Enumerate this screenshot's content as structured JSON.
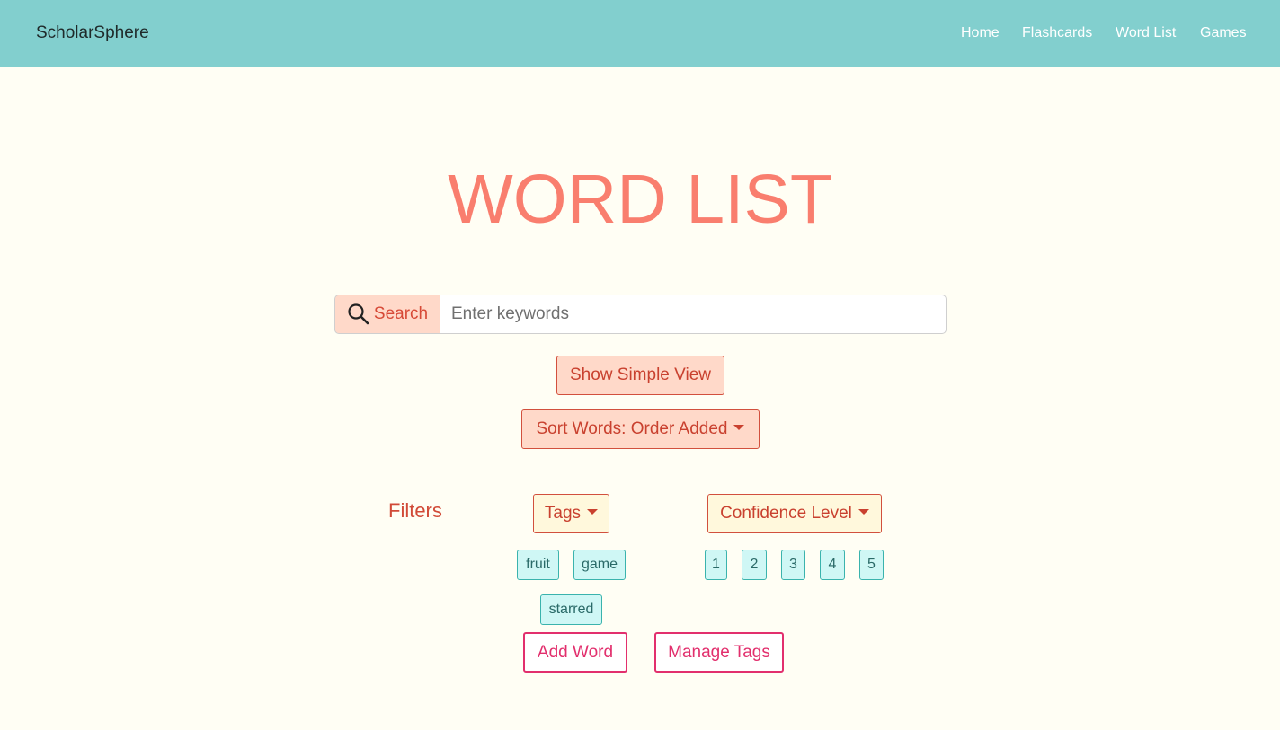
{
  "navbar": {
    "brand": "ScholarSphere",
    "links": [
      "Home",
      "Flashcards",
      "Word List",
      "Games"
    ]
  },
  "page_title": "WORD LIST",
  "search": {
    "button_label": "Search",
    "icon": "search-icon",
    "placeholder": "Enter keywords",
    "value": ""
  },
  "view_toggle_label": "Show Simple View",
  "sort_label": "Sort Words: Order Added",
  "filters": {
    "label": "Filters",
    "tags_dropdown": "Tags",
    "confidence_dropdown": "Confidence Level",
    "tags": [
      "fruit",
      "game",
      "starred"
    ],
    "confidence_levels": [
      "1",
      "2",
      "3",
      "4",
      "5"
    ]
  },
  "actions": {
    "add_word": "Add Word",
    "manage_tags": "Manage Tags"
  },
  "colors": {
    "navbar": "#82cfce",
    "background": "#fffef4",
    "title": "#f97e6e",
    "accent": "#d2503d",
    "chip": "#cff7f5",
    "action": "#e22f6d"
  }
}
